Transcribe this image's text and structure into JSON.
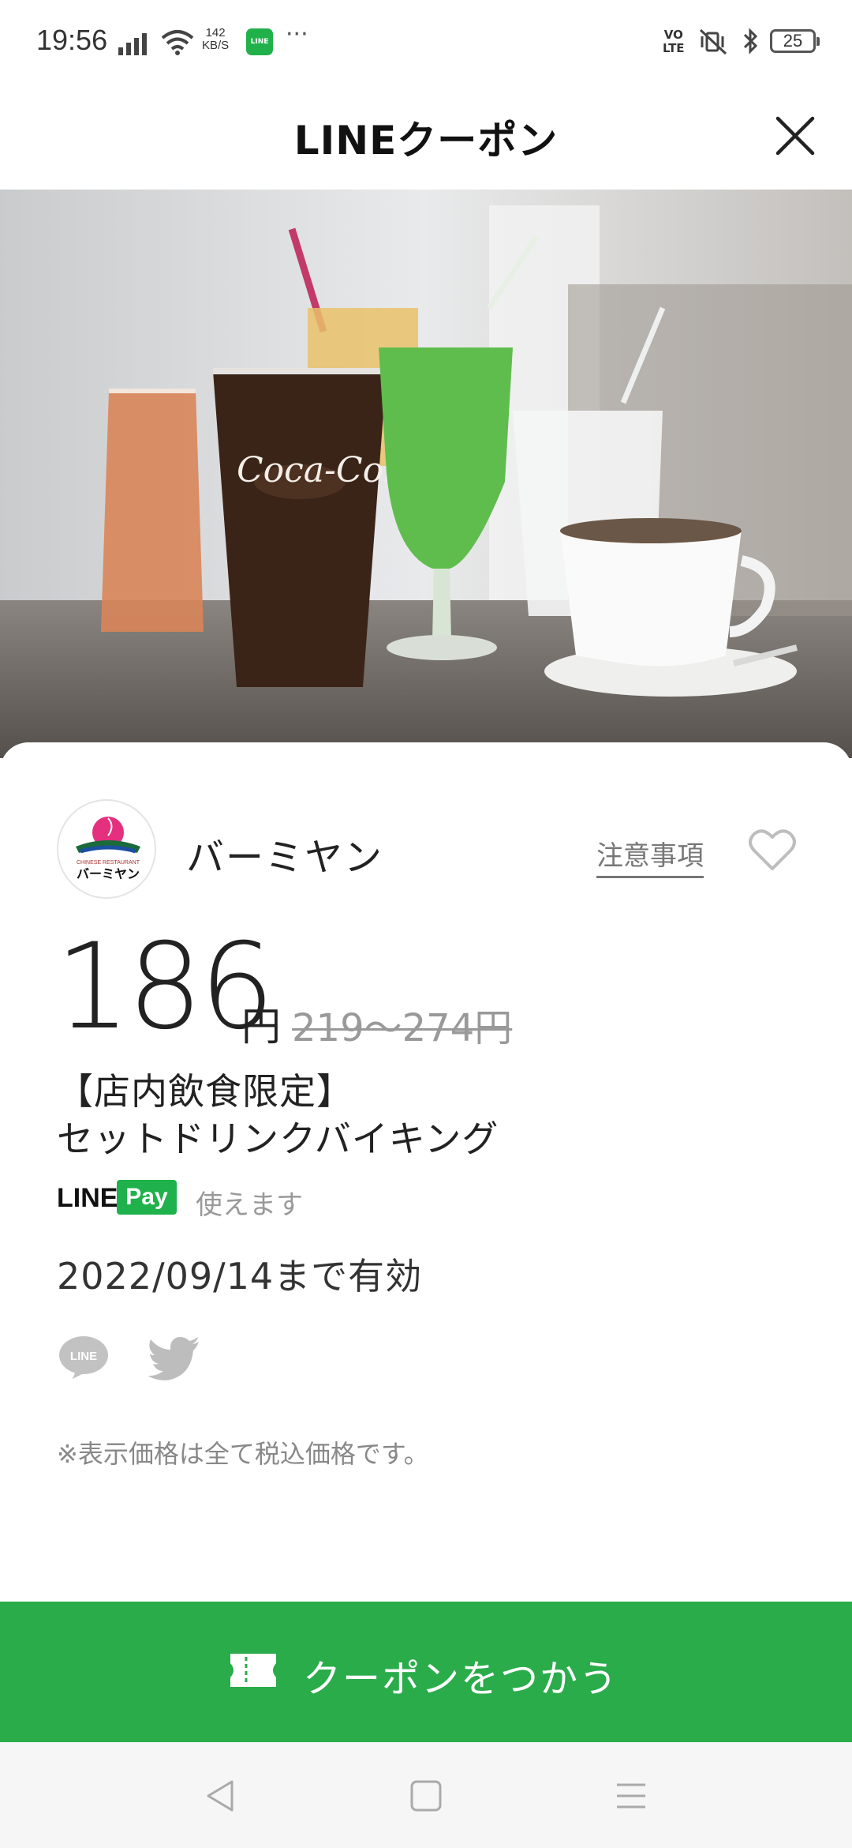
{
  "status_bar": {
    "time": "19:56",
    "net_speed_value": "142",
    "net_speed_unit": "KB/S",
    "line_app_label": "LINE",
    "more": "···",
    "volte_top": "VO",
    "volte_bottom": "LTE",
    "battery": "25"
  },
  "header": {
    "title": "LINEクーポン"
  },
  "hero": {
    "cup_brand_text": "Coca-Cola"
  },
  "shop": {
    "name": "バーミヤン",
    "logo_text": "バーミヤン",
    "logo_subtext": "CHINESE RESTAURANT",
    "notes_link": "注意事項"
  },
  "price": {
    "value": "186",
    "unit": "円",
    "original": "219〜274円"
  },
  "coupon": {
    "title_line1": "【店内飲食限定】",
    "title_line2": "セットドリンクバイキング"
  },
  "payment": {
    "line_label": "LINE",
    "pay_label": "Pay",
    "usable_text": "使えます"
  },
  "expiry": "2022/09/14まで有効",
  "share": {
    "line_label": "LINE"
  },
  "tax_note": "※表示価格は全て税込価格です。",
  "cta": {
    "label": "クーポンをつかう"
  },
  "colors": {
    "brand_green": "#2aac4a",
    "line_pay_green": "#1fb14b",
    "text_dark": "#222222",
    "text_muted": "#999999"
  }
}
